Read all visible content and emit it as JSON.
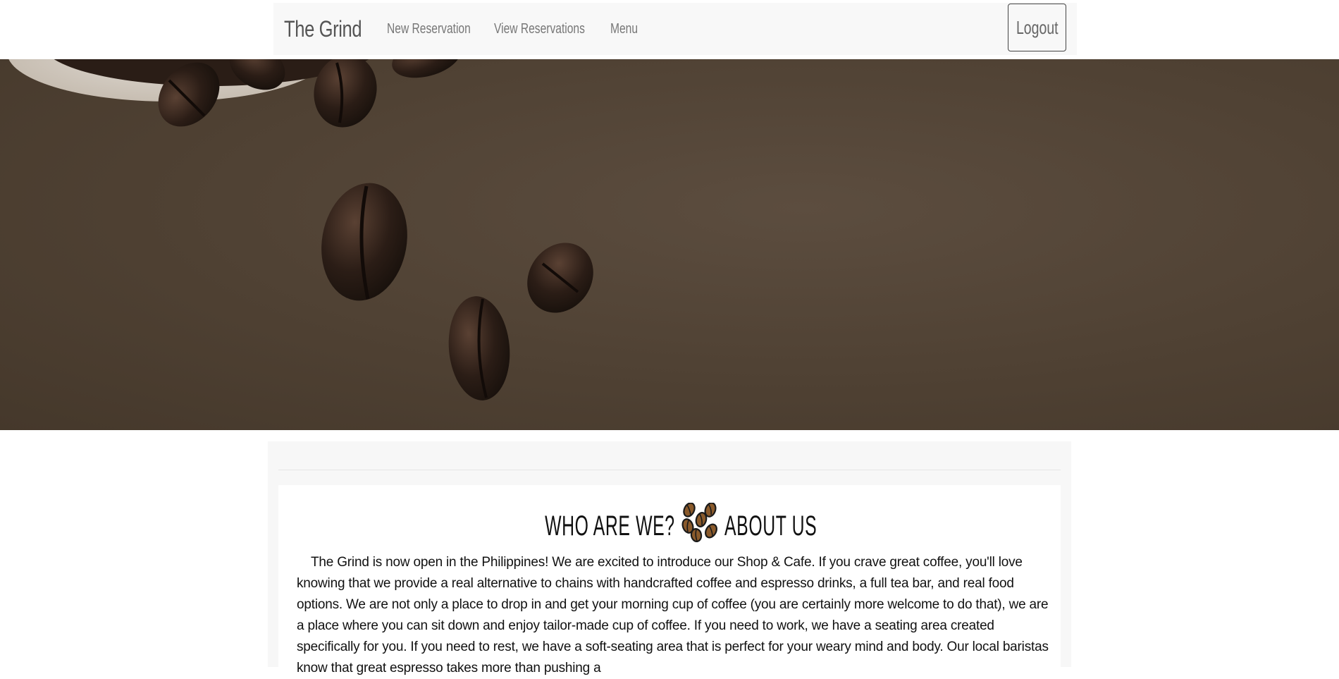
{
  "navbar": {
    "brand": "The Grind",
    "links": [
      "New Reservation",
      "View Reservations",
      "Menu"
    ],
    "logout_label": "Logout"
  },
  "colors": {
    "navbar_bg": "#f8f8f8",
    "hero_bg": "#4f4133",
    "bean": "#2a1d16",
    "content_bg": "#f7f7f7"
  },
  "about": {
    "heading_left": "who are we?",
    "heading_icon": "coffee-beans-icon",
    "heading_right": "About Us",
    "body": "The Grind is now open in the Philippines! We are excited to introduce our Shop & Cafe. If you crave great coffee, you'll love knowing that we provide a real alternative to chains with handcrafted coffee and espresso drinks, a full tea bar, and real food options. We are not only a place to drop in and get your morning cup of coffee (you are certainly more welcome to do that), we are a place where you can sit down and enjoy tailor-made cup of coffee. If you need to work, we have a seating area created specifically for you. If you need to rest, we have a soft-seating area that is perfect for your weary mind and body. Our local baristas know that great espresso takes more than pushing a"
  }
}
